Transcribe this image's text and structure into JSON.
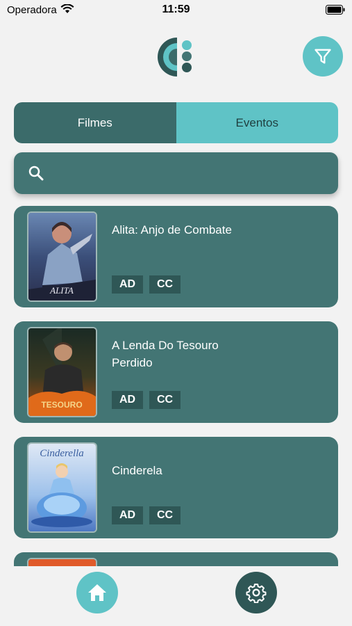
{
  "status_bar": {
    "carrier": "Operadora",
    "time": "11:59"
  },
  "tabs": [
    {
      "label": "Filmes",
      "active": true
    },
    {
      "label": "Eventos",
      "active": false
    }
  ],
  "search": {
    "value": "",
    "placeholder": ""
  },
  "movies": [
    {
      "title": "Alita: Anjo de Combate",
      "badges": [
        "AD",
        "CC"
      ]
    },
    {
      "title": "A Lenda Do Tesouro Perdido",
      "badges": [
        "AD",
        "CC"
      ]
    },
    {
      "title": "Cinderela",
      "badges": [
        "AD",
        "CC"
      ]
    }
  ],
  "colors": {
    "accent": "#5fc3c6",
    "dark_teal": "#3b6b6a",
    "card": "#437574",
    "badge": "#2f5756",
    "background": "#f2f2f2"
  },
  "icons": {
    "filter": "filter-icon",
    "search": "search-icon",
    "home": "home-icon",
    "settings": "gear-icon"
  }
}
